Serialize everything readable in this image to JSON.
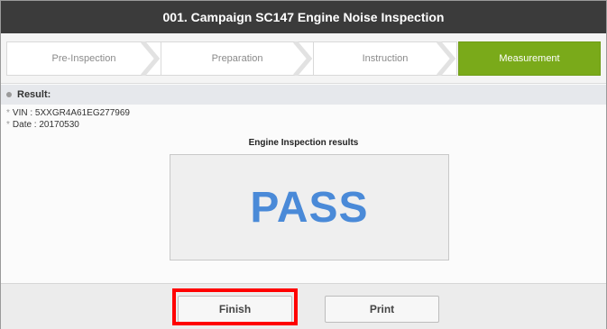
{
  "window": {
    "title": "001. Campaign SC147 Engine Noise Inspection"
  },
  "steps": [
    {
      "label": "Pre-Inspection",
      "active": false
    },
    {
      "label": "Preparation",
      "active": false
    },
    {
      "label": "Instruction",
      "active": false
    },
    {
      "label": "Measurement",
      "active": true
    }
  ],
  "result": {
    "heading": "Result:",
    "vin": "VIN : 5XXGR4A61EG277969",
    "date": "Date : 20170530"
  },
  "inspection": {
    "title": "Engine Inspection results",
    "status": "PASS"
  },
  "footer": {
    "finish_label": "Finish",
    "print_label": "Print"
  },
  "colors": {
    "titlebar": "#3b3b3b",
    "active_step": "#7aaa1a",
    "pass_text": "#4a8ad8",
    "highlight": "#ff0000"
  }
}
